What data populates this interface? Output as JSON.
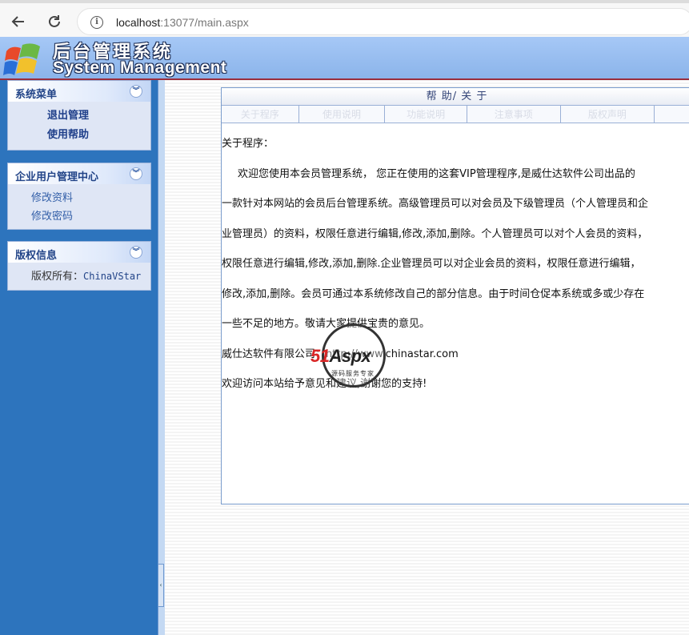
{
  "browser": {
    "url_host": "localhost",
    "url_rest": ":13077/main.aspx"
  },
  "header": {
    "title_cn": "后台管理系统",
    "title_en": "System Management"
  },
  "sidebar": {
    "panels": [
      {
        "title": "系统菜单",
        "items": [
          "退出管理",
          "使用帮助"
        ]
      },
      {
        "title": "企业用户管理中心",
        "items": [
          "修改资料",
          "修改密码"
        ]
      },
      {
        "title": "版权信息",
        "copyright_label": "版权所有：",
        "copyright_value": "ChinaVStar"
      }
    ]
  },
  "main": {
    "box_title": "帮 助/ 关 于",
    "tabs": [
      "关于程序",
      "使用说明",
      "功能说明",
      "注意事项",
      "版权声明",
      ""
    ],
    "heading": "关于程序：",
    "paragraphs": [
      "欢迎您使用本会员管理系统，  您正在使用的这套VIP管理程序,是威仕达软件公司出品的",
      "一款针对本网站的会员后台管理系统。高级管理员可以对会员及下级管理员（个人管理员和企",
      "业管理员）的资料，权限任意进行编辑,修改,添加,删除。个人管理员可以对个人会员的资料，",
      "权限任意进行编辑,修改,添加,删除.企业管理员可以对企业会员的资料，权限任意进行编辑，",
      "修改,添加,删除。会员可通过本系统修改自己的部分信息。由于时间仓促本系统或多或少存在",
      "一些不足的地方。敬请大家提供宝贵的意见。",
      "威仕达软件有限公司：http://www.chinastar.com",
      "欢迎访问本站给予意见和建议,谢谢您的支持!"
    ]
  },
  "watermark": {
    "brand_red": "51",
    "brand_dark": "Aspx",
    "sub": "源码服务专家"
  }
}
